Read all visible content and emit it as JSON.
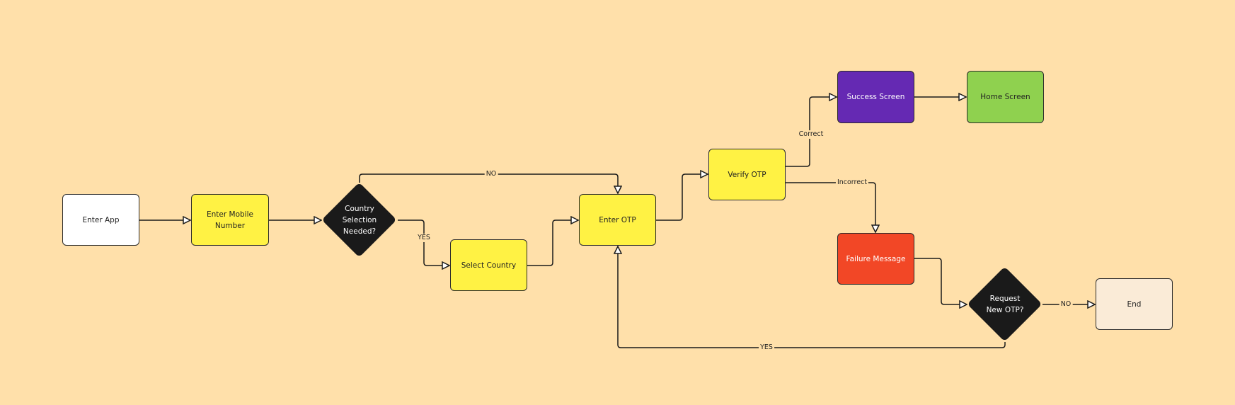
{
  "colors": {
    "background": "#FFE0AA",
    "process": "#FFF244",
    "success": "#6529B3",
    "home": "#8FD14F",
    "failure": "#F24726",
    "end": "#FAEBD7",
    "decision": "#1A1A1A",
    "start": "#FFFFFF"
  },
  "nodes": {
    "enter_app": "Enter App",
    "enter_mobile": "Enter Mobile Number",
    "country_decision": "Country Selection Needed?",
    "select_country": "Select Country",
    "enter_otp": "Enter OTP",
    "verify_otp": "Verify OTP",
    "success": "Success Screen",
    "home": "Home Screen",
    "failure": "Failure Message",
    "request_decision": "Request New OTP?",
    "end": "End"
  },
  "edges": {
    "no_country": "NO",
    "yes_country": "YES",
    "correct": "Correct",
    "incorrect": "Incorrect",
    "no_request": "NO",
    "yes_request": "YES"
  }
}
